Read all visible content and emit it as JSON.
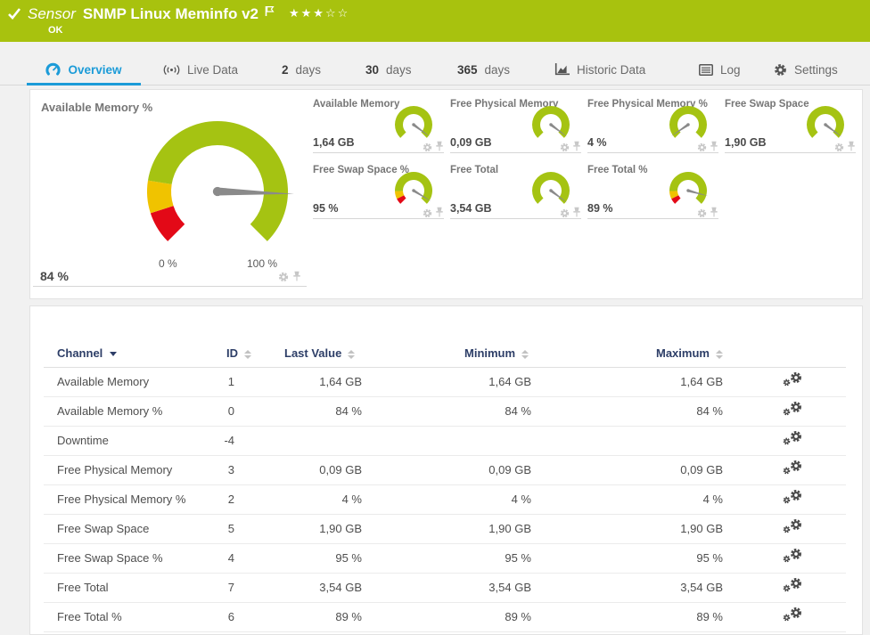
{
  "header": {
    "sensor_label": "Sensor",
    "sensor_name": "SNMP Linux Meminfo v2",
    "status": "OK",
    "rating_filled": "★★★",
    "rating_empty": "☆☆"
  },
  "tabs": [
    {
      "id": "overview",
      "label": "Overview",
      "icon": "gauge-icon",
      "active": true
    },
    {
      "id": "live-data",
      "label": "Live Data",
      "icon": "broadcast-icon",
      "active": false
    },
    {
      "id": "2-days",
      "num": "2",
      "label": "days",
      "active": false
    },
    {
      "id": "30-days",
      "num": "30",
      "label": "days",
      "active": false
    },
    {
      "id": "365-days",
      "num": "365",
      "label": "days",
      "active": false
    },
    {
      "id": "historic-data",
      "label": "Historic Data",
      "icon": "chart-icon",
      "active": false
    },
    {
      "id": "log",
      "label": "Log",
      "icon": "log-icon",
      "active": false
    },
    {
      "id": "settings",
      "label": "Settings",
      "icon": "gear-icon",
      "active": false
    }
  ],
  "colors": {
    "brand_green": "#a8c20e",
    "gauge_green": "#a5c312",
    "gauge_yellow": "#f0c300",
    "gauge_red": "#e30917",
    "needle_gray": "#8a8a8a",
    "active_blue": "#1b9bd8",
    "table_header_navy": "#2d3e67"
  },
  "gauges": {
    "main": {
      "title": "Available Memory %",
      "value": "84 %",
      "min_label": "0 %",
      "max_label": "100 %",
      "fraction": 0.84,
      "segments": [
        {
          "from": 0,
          "to": 0.1,
          "color": "#e30917"
        },
        {
          "from": 0.1,
          "to": 0.2,
          "color": "#f0c300"
        },
        {
          "from": 0.2,
          "to": 1.0,
          "color": "#a5c312"
        }
      ]
    },
    "small": [
      {
        "title": "Available Memory",
        "value": "1,64 GB",
        "fraction": 0.97,
        "limits": false
      },
      {
        "title": "Free Physical Memory",
        "value": "0,09 GB",
        "fraction": 0.97,
        "limits": false
      },
      {
        "title": "Free Physical Memory %",
        "value": "4 %",
        "fraction": 0.04,
        "limits": false
      },
      {
        "title": "Free Swap Space",
        "value": "1,90 GB",
        "fraction": 0.97,
        "limits": false
      },
      {
        "title": "Free Swap Space %",
        "value": "95 %",
        "fraction": 0.95,
        "limits": true
      },
      {
        "title": "Free Total",
        "value": "3,54 GB",
        "fraction": 0.97,
        "limits": false
      },
      {
        "title": "Free Total %",
        "value": "89 %",
        "fraction": 0.89,
        "limits": true
      }
    ],
    "limit_segments": [
      {
        "from": 0,
        "to": 0.07,
        "color": "#e30917"
      },
      {
        "from": 0.07,
        "to": 0.16,
        "color": "#f0c300"
      },
      {
        "from": 0.16,
        "to": 1.0,
        "color": "#a5c312"
      }
    ]
  },
  "table": {
    "columns": [
      {
        "key": "channel",
        "label": "Channel",
        "sort": "desc"
      },
      {
        "key": "id",
        "label": "ID",
        "sort": "none"
      },
      {
        "key": "last",
        "label": "Last Value",
        "sort": "none"
      },
      {
        "key": "min",
        "label": "Minimum",
        "sort": "none"
      },
      {
        "key": "max",
        "label": "Maximum",
        "sort": "none"
      }
    ],
    "rows": [
      {
        "channel": "Available Memory",
        "id": "1",
        "last": "1,64 GB",
        "min": "1,64 GB",
        "max": "1,64 GB"
      },
      {
        "channel": "Available Memory %",
        "id": "0",
        "last": "84 %",
        "min": "84 %",
        "max": "84 %"
      },
      {
        "channel": "Downtime",
        "id": "-4",
        "last": "",
        "min": "",
        "max": ""
      },
      {
        "channel": "Free Physical Memory",
        "id": "3",
        "last": "0,09 GB",
        "min": "0,09 GB",
        "max": "0,09 GB"
      },
      {
        "channel": "Free Physical Memory %",
        "id": "2",
        "last": "4 %",
        "min": "4 %",
        "max": "4 %"
      },
      {
        "channel": "Free Swap Space",
        "id": "5",
        "last": "1,90 GB",
        "min": "1,90 GB",
        "max": "1,90 GB"
      },
      {
        "channel": "Free Swap Space %",
        "id": "4",
        "last": "95 %",
        "min": "95 %",
        "max": "95 %"
      },
      {
        "channel": "Free Total",
        "id": "7",
        "last": "3,54 GB",
        "min": "3,54 GB",
        "max": "3,54 GB"
      },
      {
        "channel": "Free Total %",
        "id": "6",
        "last": "89 %",
        "min": "89 %",
        "max": "89 %"
      }
    ]
  }
}
